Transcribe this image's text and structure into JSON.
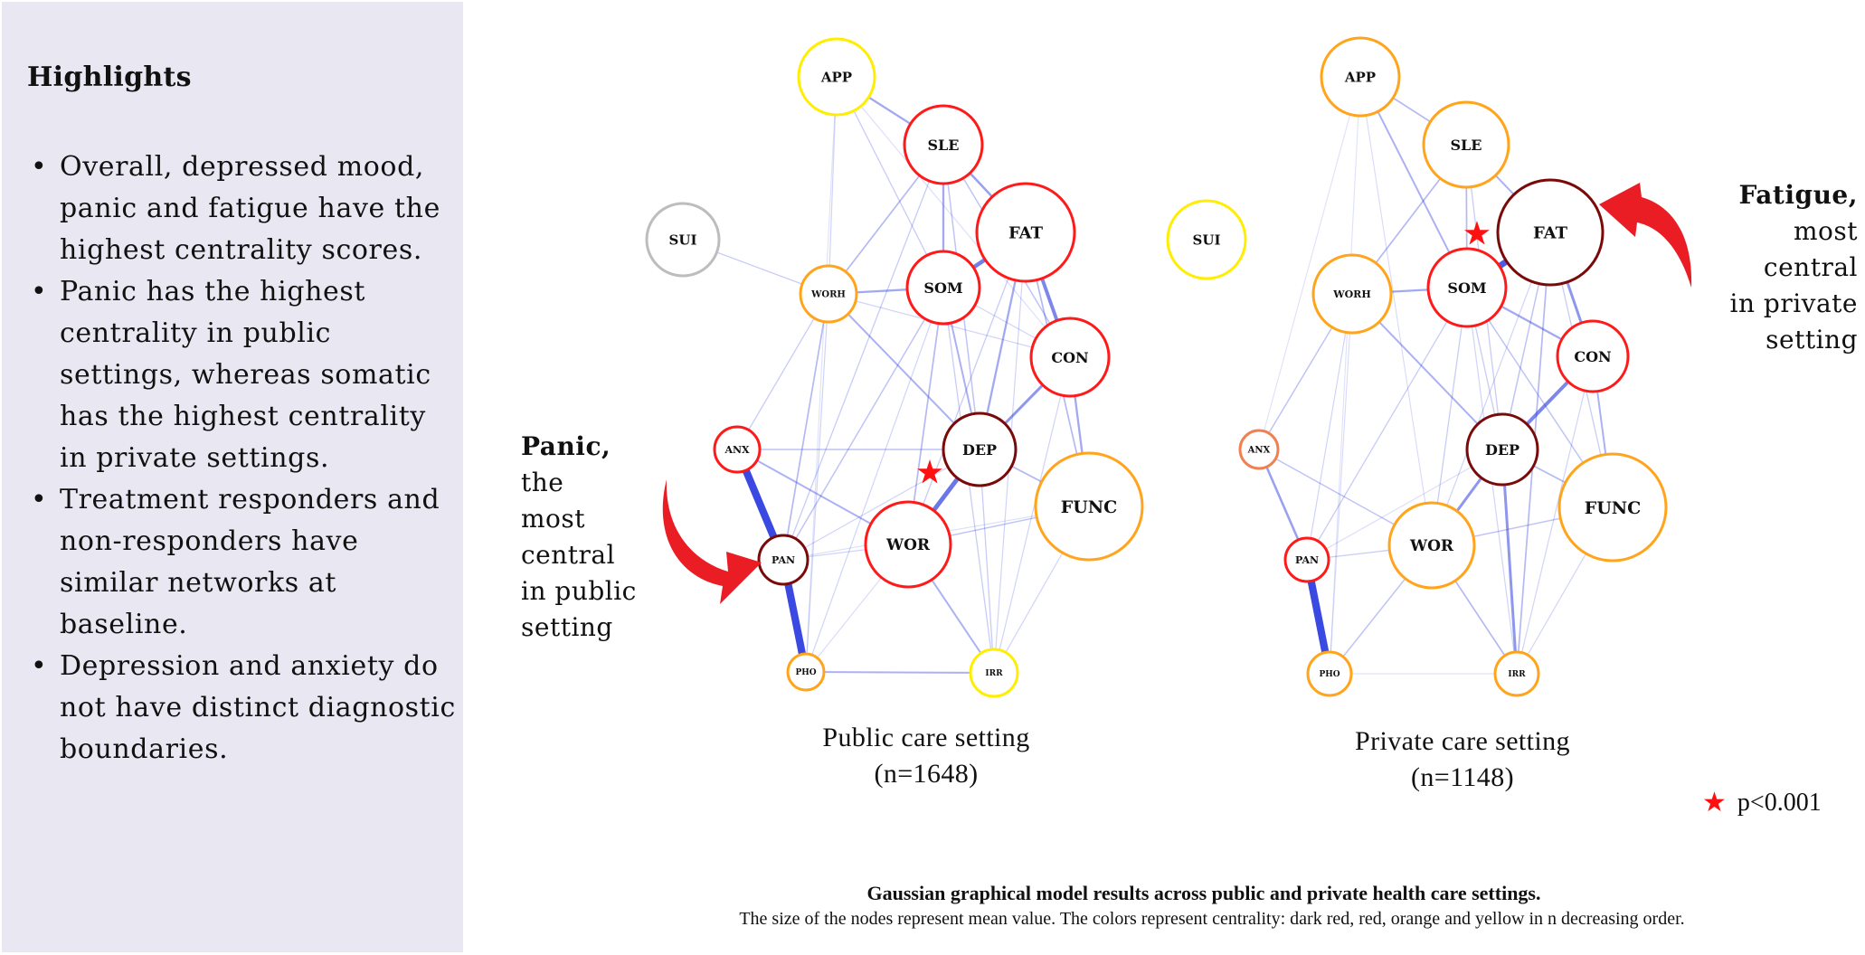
{
  "highlights": {
    "title": "Highlights",
    "items": [
      "Overall, depressed mood, panic and fatigue have the highest centrality scores.",
      "Panic has the highest centrality in public settings, whereas somatic has the highest centrality in private settings.",
      "Treatment responders and non-responders have similar networks at baseline.",
      "Depression and anxiety do not have distinct diagnostic boundaries."
    ]
  },
  "annotations": {
    "public": {
      "bold": "Panic,",
      "rest": [
        "the",
        "most",
        "central",
        "in public",
        "setting"
      ]
    },
    "private": {
      "bold": "Fatigue,",
      "rest": [
        "most",
        "central",
        "in private",
        "setting"
      ]
    }
  },
  "centrality_colors": {
    "dark_red": "#7a0a0a",
    "red": "#ff1a1a",
    "orange": "#ffa41b",
    "coral": "#f08050",
    "yellow": "#ffee00",
    "gray": "#bdbdbd"
  },
  "edge_color": "#2233dd",
  "star_color": "#ff1010",
  "networks": [
    {
      "id": "public",
      "title": "Public care setting",
      "n_label": "(n=1648)",
      "star_node": "DEP",
      "nodes": [
        {
          "id": "APP",
          "centrality": "yellow"
        },
        {
          "id": "SLE",
          "centrality": "red"
        },
        {
          "id": "FAT",
          "centrality": "red"
        },
        {
          "id": "SUI",
          "centrality": "gray"
        },
        {
          "id": "WORH",
          "centrality": "orange"
        },
        {
          "id": "SOM",
          "centrality": "red"
        },
        {
          "id": "CON",
          "centrality": "red"
        },
        {
          "id": "ANX",
          "centrality": "red"
        },
        {
          "id": "DEP",
          "centrality": "dark_red"
        },
        {
          "id": "FUNC",
          "centrality": "orange"
        },
        {
          "id": "PAN",
          "centrality": "dark_red"
        },
        {
          "id": "WOR",
          "centrality": "red"
        },
        {
          "id": "PHO",
          "centrality": "orange"
        },
        {
          "id": "IRR",
          "centrality": "yellow"
        }
      ],
      "edges": [
        [
          "ANX",
          "PAN",
          0.95
        ],
        [
          "PAN",
          "PHO",
          0.95
        ],
        [
          "DEP",
          "WOR",
          0.7
        ],
        [
          "SOM",
          "FAT",
          0.65
        ],
        [
          "FAT",
          "CON",
          0.6
        ],
        [
          "CON",
          "DEP",
          0.5
        ],
        [
          "SLE",
          "FAT",
          0.45
        ],
        [
          "SLE",
          "SOM",
          0.4
        ],
        [
          "APP",
          "SLE",
          0.4
        ],
        [
          "WORH",
          "SOM",
          0.4
        ],
        [
          "FAT",
          "DEP",
          0.4
        ],
        [
          "ANX",
          "WOR",
          0.35
        ],
        [
          "WORH",
          "DEP",
          0.35
        ],
        [
          "PHO",
          "IRR",
          0.35
        ],
        [
          "WOR",
          "IRR",
          0.35
        ],
        [
          "CON",
          "FUNC",
          0.4
        ],
        [
          "SOM",
          "DEP",
          0.35
        ],
        [
          "SLE",
          "WORH",
          0.3
        ],
        [
          "SOM",
          "WOR",
          0.3
        ],
        [
          "DEP",
          "FUNC",
          0.3
        ],
        [
          "WOR",
          "FUNC",
          0.25
        ],
        [
          "WORH",
          "PAN",
          0.3
        ],
        [
          "ANX",
          "DEP",
          0.25
        ],
        [
          "SUI",
          "WORH",
          0.2
        ],
        [
          "APP",
          "SOM",
          0.2
        ],
        [
          "APP",
          "WORH",
          0.15
        ],
        [
          "SLE",
          "DEP",
          0.25
        ],
        [
          "SOM",
          "IRR",
          0.2
        ],
        [
          "FAT",
          "FUNC",
          0.3
        ],
        [
          "SOM",
          "PAN",
          0.25
        ],
        [
          "WORH",
          "ANX",
          0.2
        ],
        [
          "CON",
          "WORH",
          0.15
        ],
        [
          "SLE",
          "CON",
          0.25
        ],
        [
          "FAT",
          "WOR",
          0.2
        ],
        [
          "DEP",
          "IRR",
          0.2
        ],
        [
          "FUNC",
          "IRR",
          0.15
        ],
        [
          "PAN",
          "DEP",
          0.15
        ],
        [
          "SOM",
          "CON",
          0.15
        ],
        [
          "WORH",
          "PHO",
          0.15
        ],
        [
          "APP",
          "PHO",
          0.08
        ],
        [
          "SLE",
          "PAN",
          0.2
        ],
        [
          "SOM",
          "PHO",
          0.15
        ],
        [
          "FAT",
          "IRR",
          0.15
        ],
        [
          "CON",
          "IRR",
          0.15
        ],
        [
          "WOR",
          "PHO",
          0.12
        ],
        [
          "PAN",
          "FUNC",
          0.1
        ],
        [
          "APP",
          "CON",
          0.1
        ],
        [
          "PAN",
          "WOR",
          0.15
        ]
      ]
    },
    {
      "id": "private",
      "title": "Private care setting",
      "n_label": "(n=1148)",
      "star_node": "FAT",
      "nodes": [
        {
          "id": "APP",
          "centrality": "orange"
        },
        {
          "id": "SLE",
          "centrality": "orange"
        },
        {
          "id": "FAT",
          "centrality": "dark_red"
        },
        {
          "id": "SUI",
          "centrality": "yellow"
        },
        {
          "id": "WORH",
          "centrality": "orange"
        },
        {
          "id": "SOM",
          "centrality": "red"
        },
        {
          "id": "CON",
          "centrality": "red"
        },
        {
          "id": "ANX",
          "centrality": "coral"
        },
        {
          "id": "DEP",
          "centrality": "dark_red"
        },
        {
          "id": "FUNC",
          "centrality": "orange"
        },
        {
          "id": "PAN",
          "centrality": "red"
        },
        {
          "id": "WOR",
          "centrality": "orange"
        },
        {
          "id": "PHO",
          "centrality": "orange"
        },
        {
          "id": "IRR",
          "centrality": "orange"
        }
      ],
      "edges": [
        [
          "PAN",
          "PHO",
          0.95
        ],
        [
          "SOM",
          "FAT",
          0.85
        ],
        [
          "CON",
          "DEP",
          0.6
        ],
        [
          "DEP",
          "WOR",
          0.5
        ],
        [
          "FAT",
          "CON",
          0.5
        ],
        [
          "ANX",
          "PAN",
          0.45
        ],
        [
          "DEP",
          "IRR",
          0.5
        ],
        [
          "WORH",
          "SOM",
          0.4
        ],
        [
          "SOM",
          "CON",
          0.4
        ],
        [
          "WORH",
          "DEP",
          0.35
        ],
        [
          "APP",
          "SOM",
          0.35
        ],
        [
          "SLE",
          "FAT",
          0.35
        ],
        [
          "SLE",
          "WORH",
          0.3
        ],
        [
          "SLE",
          "SOM",
          0.3
        ],
        [
          "APP",
          "SLE",
          0.3
        ],
        [
          "WOR",
          "IRR",
          0.3
        ],
        [
          "FAT",
          "IRR",
          0.3
        ],
        [
          "CON",
          "FUNC",
          0.35
        ],
        [
          "DEP",
          "FUNC",
          0.3
        ],
        [
          "ANX",
          "WORH",
          0.25
        ],
        [
          "ANX",
          "WOR",
          0.25
        ],
        [
          "PHO",
          "WOR",
          0.25
        ],
        [
          "WOR",
          "FUNC",
          0.25
        ],
        [
          "PAN",
          "WOR",
          0.2
        ],
        [
          "SOM",
          "FUNC",
          0.25
        ],
        [
          "FAT",
          "DEP",
          0.25
        ],
        [
          "SOM",
          "DEP",
          0.2
        ],
        [
          "SOM",
          "PAN",
          0.2
        ],
        [
          "WORH",
          "PAN",
          0.15
        ],
        [
          "SOM",
          "WOR",
          0.2
        ],
        [
          "PHO",
          "IRR",
          0.12
        ],
        [
          "APP",
          "PHO",
          0.08
        ],
        [
          "APP",
          "ANX",
          0.08
        ],
        [
          "SLE",
          "DEP",
          0.2
        ],
        [
          "WORH",
          "PHO",
          0.12
        ],
        [
          "FAT",
          "FUNC",
          0.2
        ],
        [
          "SOM",
          "IRR",
          0.15
        ],
        [
          "CON",
          "IRR",
          0.15
        ],
        [
          "DEP",
          "PAN",
          0.1
        ],
        [
          "APP",
          "WOR",
          0.12
        ],
        [
          "FUNC",
          "IRR",
          0.15
        ],
        [
          "FAT",
          "WOR",
          0.15
        ]
      ]
    }
  ],
  "legend": {
    "star_label": "p<0.001"
  },
  "caption": {
    "title": "Gaussian graphical model results across public and private health care settings.",
    "subtitle": "The size of the nodes represent mean value. The colors represent centrality: dark red, red, orange and yellow in n decreasing order."
  }
}
